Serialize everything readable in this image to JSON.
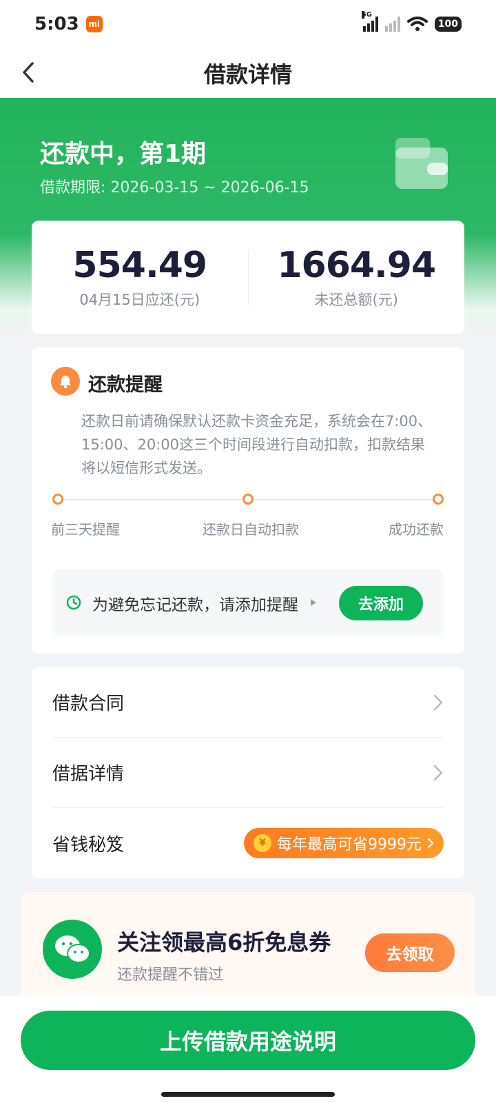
{
  "status_bar": {
    "time": "5:03",
    "network": "5G",
    "battery": "100"
  },
  "nav": {
    "title": "借款详情"
  },
  "hero": {
    "status": "还款中，第1期",
    "period": "借款期限: 2026-03-15 ~ 2026-06-15"
  },
  "amounts": {
    "due": {
      "value": "554.49",
      "label": "04月15日应还(元)"
    },
    "unpaid": {
      "value": "1664.94",
      "label": "未还总额(元)"
    }
  },
  "reminder": {
    "title": "还款提醒",
    "text": "还款日前请确保默认还款卡资金充足，系统会在7:00、15:00、20:00这三个时间段进行自动扣款，扣款结果将以短信形式发送。",
    "steps": [
      "前三天提醒",
      "还款日自动扣款",
      "成功还款"
    ],
    "add_prompt": "为避免忘记还款，请添加提醒",
    "add_button": "去添加"
  },
  "list": {
    "contract": "借款合同",
    "receipt": "借据详情",
    "savings": "省钱秘笈",
    "savings_badge": "每年最高可省9999元",
    "coin_symbol": "¥"
  },
  "follow": {
    "title": "关注领最高6折免息券",
    "subtitle": "还款提醒不错过",
    "button": "去领取"
  },
  "bottom": {
    "upload_button": "上传借款用途说明"
  },
  "colors": {
    "primary_green": "#0db45a",
    "accent_orange": "#ff8a3d"
  }
}
